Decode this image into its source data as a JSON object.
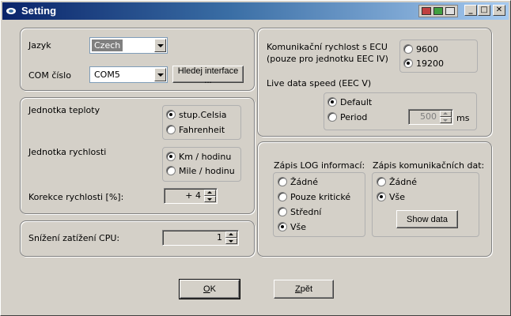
{
  "window": {
    "title": "Setting"
  },
  "language": {
    "label": "Jazyk",
    "value": "Czech"
  },
  "com": {
    "label": "COM číslo",
    "value": "COM5",
    "search_button": "Hledej interface ..."
  },
  "temperature": {
    "label": "Jednotka teploty",
    "options": [
      "stup.Celsia",
      "Fahrenheit"
    ],
    "selected": "stup.Celsia"
  },
  "speed_unit": {
    "label": "Jednotka rychlosti",
    "options": [
      "Km / hodinu",
      "Mile / hodinu"
    ],
    "selected": "Km / hodinu"
  },
  "speed_correction": {
    "label": "Korekce rychlosti [%]:",
    "value": "+ 4"
  },
  "cpu": {
    "label": "Snížení zatížení CPU:",
    "value": "1"
  },
  "ecu_speed": {
    "label_line1": "Komunikační rychlost s ECU",
    "label_line2": "(pouze pro jednotku EEC IV)",
    "options": [
      "9600",
      "19200"
    ],
    "selected": "19200"
  },
  "live_speed": {
    "label": "Live data speed (EEC V)",
    "options": [
      "Default",
      "Period"
    ],
    "selected": "Default",
    "period_value": "500",
    "unit": "ms"
  },
  "log_info": {
    "label": "Zápis LOG informací:",
    "options": [
      "Žádné",
      "Pouze kritické",
      "Střední",
      "Vše"
    ],
    "selected": "Vše"
  },
  "comm_log": {
    "label": "Zápis komunikačních dat:",
    "options": [
      "Žádné",
      "Vše"
    ],
    "selected": "Vše",
    "show_button": "Show data"
  },
  "buttons": {
    "ok_first": "O",
    "ok_rest": "K",
    "back_first": "Z",
    "back_rest": "pět"
  }
}
